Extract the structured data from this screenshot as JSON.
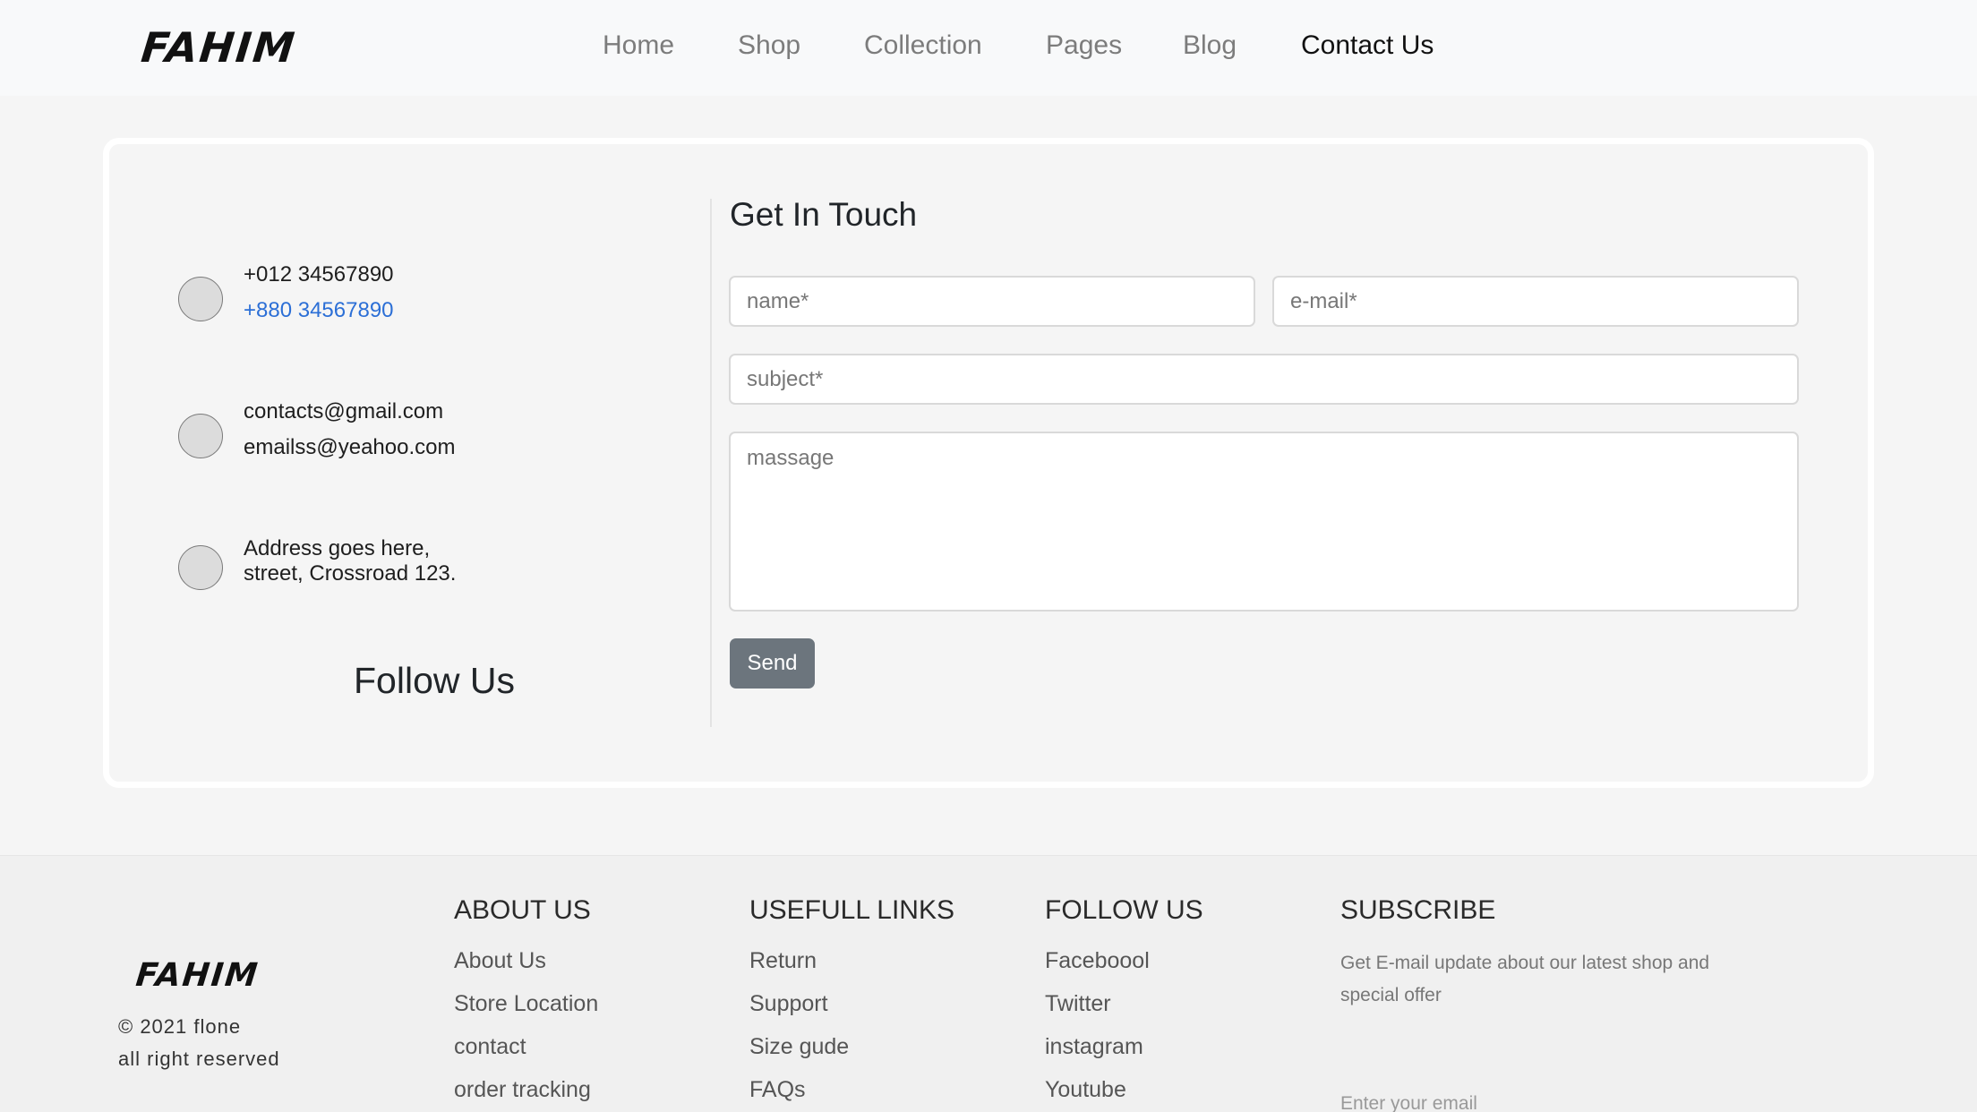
{
  "header": {
    "logo": "FAHIM",
    "nav": [
      "Home",
      "Shop",
      "Collection",
      "Pages",
      "Blog",
      "Contact Us"
    ],
    "active_nav": "Contact Us"
  },
  "contact_info": {
    "phone": {
      "icon": "phone-icon",
      "primary": "+012 34567890",
      "secondary": "+880 34567890"
    },
    "email": {
      "icon": "email-icon",
      "primary": "contacts@gmail.com",
      "secondary": "emailss@yeahoo.com"
    },
    "address": {
      "icon": "location-icon",
      "line1": "Address goes here,",
      "line2": "street, Crossroad 123."
    },
    "follow_title": "Follow Us"
  },
  "form": {
    "title": "Get In Touch",
    "name_placeholder": "name*",
    "email_placeholder": "e-mail*",
    "subject_placeholder": "subject*",
    "message_placeholder": "massage",
    "send_label": "Send"
  },
  "footer": {
    "logo": "FAHIM",
    "copyright": "© 2021 flone",
    "rights": "all right reserved",
    "about": {
      "title": "ABOUT US",
      "links": [
        "About Us",
        "Store Location",
        "contact",
        "order tracking"
      ]
    },
    "useful": {
      "title": "USEFULL LINKS",
      "links": [
        "Return",
        "Support",
        "Size gude",
        "FAQs"
      ]
    },
    "follow": {
      "title": "FOLLOW US",
      "links": [
        "Faceboool",
        "Twitter",
        "instagram",
        "Youtube"
      ]
    },
    "subscribe": {
      "title": "SUBSCRIBE",
      "text": "Get E-mail update about our latest shop and special offer",
      "placeholder": "Enter your email"
    }
  },
  "colors": {
    "accent_link": "#2c6fd6",
    "send_button": "#6c757d",
    "page_bg": "#f5f5f5"
  }
}
